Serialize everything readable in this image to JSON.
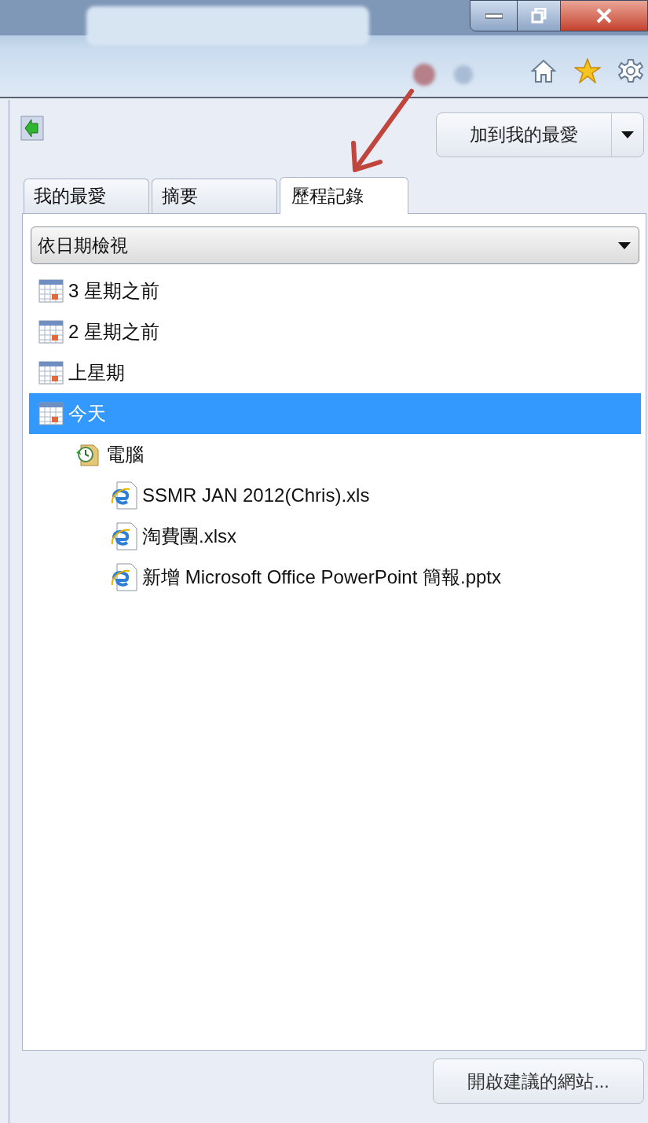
{
  "toolbar": {
    "add_favorites_button": "加到我的最愛"
  },
  "tabs": [
    {
      "label": "我的最愛",
      "selected": false
    },
    {
      "label": "摘要",
      "selected": false
    },
    {
      "label": "歷程記錄",
      "selected": true
    }
  ],
  "view_dropdown": {
    "value": "依日期檢視"
  },
  "history_tree": [
    {
      "label": "3 星期之前",
      "kind": "calendar",
      "selected": false
    },
    {
      "label": "2 星期之前",
      "kind": "calendar",
      "selected": false
    },
    {
      "label": "上星期",
      "kind": "calendar",
      "selected": false
    },
    {
      "label": "今天",
      "kind": "calendar",
      "selected": true,
      "children": [
        {
          "label": "電腦",
          "kind": "folder",
          "selected": false,
          "children": [
            {
              "label": "SSMR JAN 2012(Chris).xls",
              "kind": "page",
              "selected": false
            },
            {
              "label": "淘費團.xlsx",
              "kind": "page",
              "selected": false
            },
            {
              "label": "新增 Microsoft Office PowerPoint 簡報.pptx",
              "kind": "page",
              "selected": false
            }
          ]
        }
      ]
    }
  ],
  "footer_button": "開啟建議的網站..."
}
